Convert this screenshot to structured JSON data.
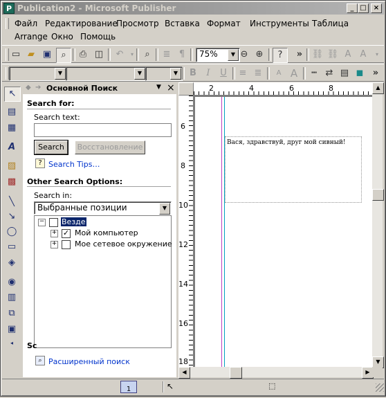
{
  "window": {
    "title": "Publication2 - Microsoft Publisher",
    "app_icon": "P"
  },
  "caption_buttons": {
    "minimize": "_",
    "maximize": "□",
    "close": "×"
  },
  "menu": {
    "row1": [
      "Файл",
      "Редактирование",
      "Просмотр",
      "Вставка",
      "Формат",
      "Инструменты",
      "Таблица"
    ],
    "row2": [
      "Arrange",
      "Окно",
      "Помощь"
    ]
  },
  "standard_toolbar": {
    "zoom": "75%",
    "more": "»"
  },
  "format_toolbar": {
    "bold": "B",
    "italic": "I",
    "underline": "U",
    "more": "»"
  },
  "task_pane": {
    "title": "Основной Поиск",
    "search_for": "Search for:",
    "search_text_label": "Search text:",
    "search_text_value": "",
    "search_button": "Search",
    "restore_button": "Восстановление",
    "search_tips": "Search Tips…",
    "other_options": "Other Search Options:",
    "search_in_label": "Search in:",
    "search_in_value": "Выбранные позиции",
    "tree": [
      {
        "label": "Везде",
        "selected": true
      },
      {
        "label": "Мой компьютер",
        "checked": true
      },
      {
        "label": "Мое сетевое окружение",
        "checked": false
      }
    ],
    "hidden_section_fragment": "Sc",
    "advanced_link": "Расширенный поиск"
  },
  "ruler_h": [
    "2",
    "4",
    "6",
    "8"
  ],
  "ruler_v": [
    "6",
    "8",
    "10",
    "12",
    "14",
    "16",
    "18"
  ],
  "textbox": {
    "text": "Вася, здравствуй, друг мой сивный!"
  },
  "statusbar": {
    "page_number": "1"
  }
}
